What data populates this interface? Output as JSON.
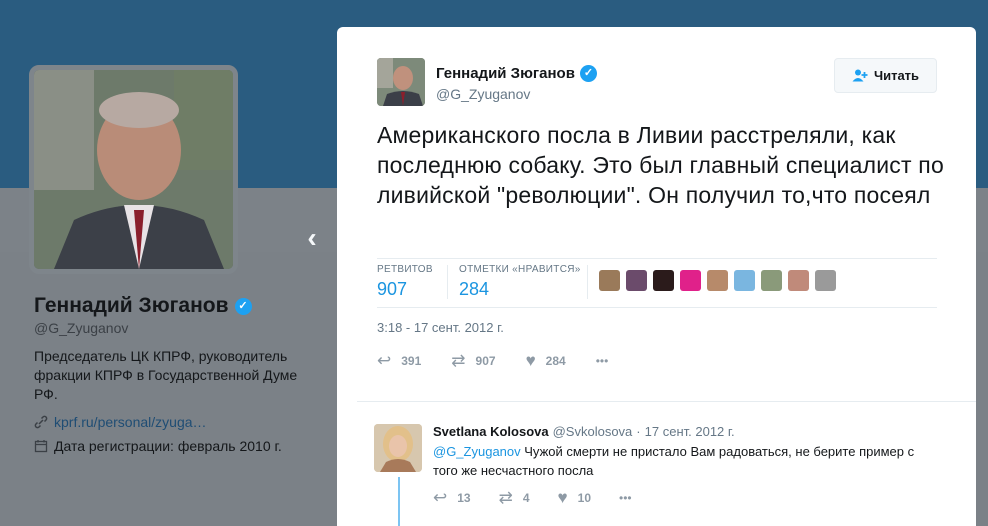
{
  "profile": {
    "name": "Геннадий Зюганов",
    "handle": "@G_Zyuganov",
    "bio": "Председатель ЦК КПРФ, руководитель фракции КПРФ в Государственной Думе РФ.",
    "link": "kprf.ru/personal/zyuga…",
    "joined": "Дата регистрации: февраль 2010 г."
  },
  "tweet": {
    "name": "Геннадий Зюганов",
    "handle": "@G_Zyuganov",
    "follow_label": "Читать",
    "text": "Американского посла в Ливии расстреляли, как последнюю собаку. Это был главный специалист по ливийской \"революции\". Он получил то,что посеял",
    "retweets_label": "РЕТВИТОВ",
    "retweets_value": "907",
    "likes_label": "ОТМЕТКИ «НРАВИТСЯ»",
    "likes_value": "284",
    "timestamp": "3:18 - 17 сент. 2012 г.",
    "actions": {
      "reply_count": "391",
      "retweet_count": "907",
      "like_count": "284"
    }
  },
  "reply": {
    "name": "Svetlana Kolosova",
    "handle": "@Svkolosova",
    "dot": "·",
    "date": "17 сент. 2012 г.",
    "mention": "@G_Zyuganov",
    "text": " Чужой смерти не пристало Вам радоваться, не берите пример с того же несчастного посла",
    "actions": {
      "reply_count": "13",
      "retweet_count": "4",
      "like_count": "10"
    }
  },
  "icons": {
    "verified": "✓",
    "follow": "person-plus-icon",
    "reply": "↩",
    "retweet": "⇄",
    "like": "♥",
    "more": "•••",
    "link": "link-icon",
    "calendar": "calendar-icon",
    "prev": "‹"
  },
  "colors": {
    "accent": "#1da1f2",
    "link": "#1b95e0",
    "muted": "#657786"
  }
}
